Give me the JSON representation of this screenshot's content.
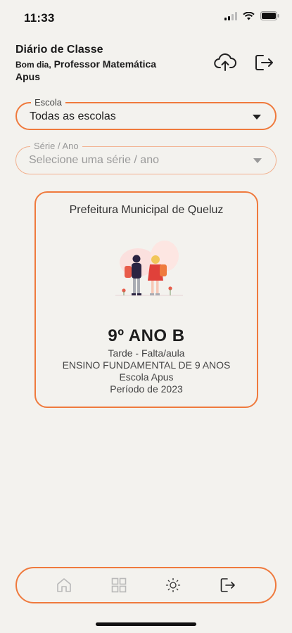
{
  "status_bar": {
    "time": "11:33"
  },
  "header": {
    "app_title": "Diário de Classe",
    "greeting_prefix": "Bom dia,",
    "user_name_line1": "Professor Matemática",
    "user_name_line2": "Apus"
  },
  "filters": {
    "escola": {
      "label": "Escola",
      "value": "Todas as escolas"
    },
    "serie": {
      "label": "Série / Ano",
      "placeholder": "Selecione uma série / ano"
    }
  },
  "class_card": {
    "organization": "Prefeitura Municipal de Queluz",
    "class_name": "9º ANO B",
    "shift": "Tarde - Falta/aula",
    "level": "ENSINO FUNDAMENTAL DE 9 ANOS",
    "school": "Escola Apus",
    "period": "Período de 2023"
  },
  "icons": {
    "header_upload": "cloud-upload-icon",
    "header_logout": "logout-icon",
    "nav": [
      "home-icon",
      "grid-icon",
      "sun-icon",
      "logout-icon"
    ]
  },
  "colors": {
    "accent": "#ef7a3d",
    "background": "#f3f2ee"
  }
}
